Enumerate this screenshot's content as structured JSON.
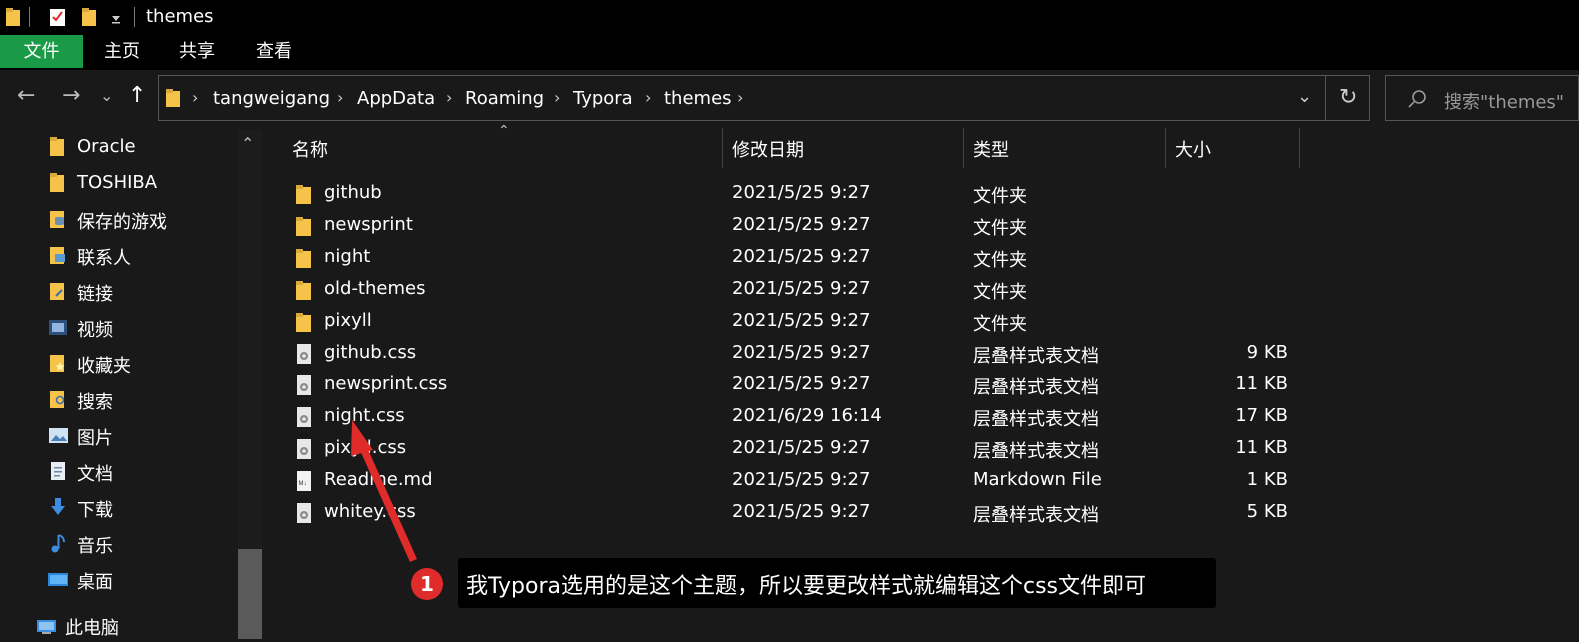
{
  "window": {
    "title": "themes"
  },
  "ribbon": {
    "tabs": [
      {
        "label": "文件",
        "active": true
      },
      {
        "label": "主页"
      },
      {
        "label": "共享"
      },
      {
        "label": "查看"
      }
    ]
  },
  "address": {
    "crumbs": [
      "tangweigang",
      "AppData",
      "Roaming",
      "Typora",
      "themes"
    ],
    "search_placeholder": "搜索\"themes\""
  },
  "sidebar": {
    "items": [
      {
        "label": "Oracle",
        "icon": "folder-icon"
      },
      {
        "label": "TOSHIBA",
        "icon": "folder-icon"
      },
      {
        "label": "保存的游戏",
        "icon": "saved-games-icon"
      },
      {
        "label": "联系人",
        "icon": "contacts-icon"
      },
      {
        "label": "链接",
        "icon": "links-icon"
      },
      {
        "label": "视频",
        "icon": "videos-icon"
      },
      {
        "label": "收藏夹",
        "icon": "favorites-icon"
      },
      {
        "label": "搜索",
        "icon": "searches-icon"
      },
      {
        "label": "图片",
        "icon": "pictures-icon"
      },
      {
        "label": "文档",
        "icon": "documents-icon"
      },
      {
        "label": "下载",
        "icon": "downloads-icon"
      },
      {
        "label": "音乐",
        "icon": "music-icon"
      },
      {
        "label": "桌面",
        "icon": "desktop-icon"
      },
      {
        "label": "此电脑",
        "icon": "this-pc-icon"
      }
    ]
  },
  "columns": {
    "name": "名称",
    "date": "修改日期",
    "type": "类型",
    "size": "大小"
  },
  "files": [
    {
      "name": "github",
      "date": "2021/5/25 9:27",
      "type": "文件夹",
      "size": "",
      "kind": "folder"
    },
    {
      "name": "newsprint",
      "date": "2021/5/25 9:27",
      "type": "文件夹",
      "size": "",
      "kind": "folder"
    },
    {
      "name": "night",
      "date": "2021/5/25 9:27",
      "type": "文件夹",
      "size": "",
      "kind": "folder"
    },
    {
      "name": "old-themes",
      "date": "2021/5/25 9:27",
      "type": "文件夹",
      "size": "",
      "kind": "folder"
    },
    {
      "name": "pixyll",
      "date": "2021/5/25 9:27",
      "type": "文件夹",
      "size": "",
      "kind": "folder"
    },
    {
      "name": "github.css",
      "date": "2021/5/25 9:27",
      "type": "层叠样式表文档",
      "size": "9 KB",
      "kind": "css"
    },
    {
      "name": "newsprint.css",
      "date": "2021/5/25 9:27",
      "type": "层叠样式表文档",
      "size": "11 KB",
      "kind": "css"
    },
    {
      "name": "night.css",
      "date": "2021/6/29 16:14",
      "type": "层叠样式表文档",
      "size": "17 KB",
      "kind": "css"
    },
    {
      "name": "pixyll.css",
      "date": "2021/5/25 9:27",
      "type": "层叠样式表文档",
      "size": "11 KB",
      "kind": "css"
    },
    {
      "name": "Readme.md",
      "date": "2021/5/25 9:27",
      "type": "Markdown File",
      "size": "1 KB",
      "kind": "md"
    },
    {
      "name": "whitey.css",
      "date": "2021/5/25 9:27",
      "type": "层叠样式表文档",
      "size": "5 KB",
      "kind": "css"
    }
  ],
  "annotation": {
    "number": "1",
    "text": "我Typora选用的是这个主题，所以要更改样式就编辑这个css文件即可"
  },
  "colors": {
    "folder": "#f5c24a",
    "ribbon_active": "#1a9a46",
    "badge": "#e02b2b"
  }
}
